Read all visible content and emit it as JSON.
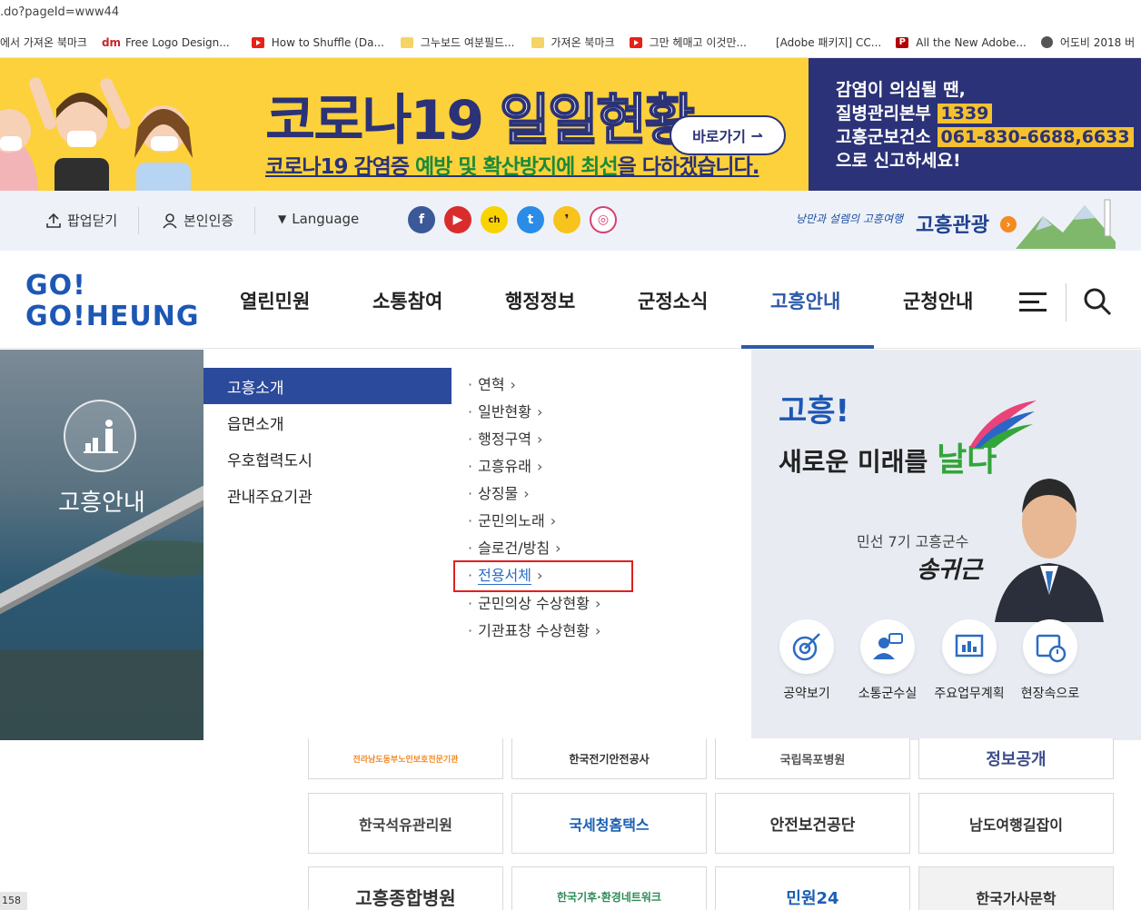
{
  "browser": {
    "url": ".do?pageId=www44",
    "bookmarks": [
      {
        "icon": "folder-icon",
        "label": "에서 가져온 북마크"
      },
      {
        "icon": "dm-icon",
        "label": "Free Logo Design..."
      },
      {
        "icon": "youtube-icon",
        "label": "How to Shuffle (Da..."
      },
      {
        "icon": "folder-icon",
        "label": "그누보드 여분필드..."
      },
      {
        "icon": "folder-icon",
        "label": "가져온 북마크"
      },
      {
        "icon": "youtube-icon",
        "label": "그만 헤매고 이것만..."
      },
      {
        "icon": "none",
        "label": "[Adobe 패키지] CC..."
      },
      {
        "icon": "p-icon",
        "label": "All the New Adobe..."
      },
      {
        "icon": "globe-icon",
        "label": "어도비 2018 버"
      }
    ],
    "status": "158"
  },
  "banner": {
    "title_a": "코로나19",
    "title_b": "일일현황",
    "subtitle_a": "코로나19 감염증 ",
    "subtitle_b": "예방 및 확산방지에 최선",
    "subtitle_c": "을 다하겠습니다.",
    "button": "바로가기",
    "right_line1": "감염이 의심될 땐,",
    "right_line2_a": "질병관리본부 ",
    "right_line2_b": "1339",
    "right_line3_a": "고흥군보건소 ",
    "right_line3_b": "061-830-6688,6633",
    "right_line4": "으로 신고하세요!"
  },
  "utility": {
    "popup_close": "팝업닫기",
    "verify": "본인인증",
    "language": "Language",
    "sns": [
      "facebook-icon",
      "youtube-icon",
      "kakaostory-icon",
      "twitter-icon",
      "kakao-icon",
      "instagram-icon"
    ],
    "tour_slogan": "낭만과 설렘의 고흥여행",
    "tour_logo": "고흥관광"
  },
  "nav": {
    "logo_line1": "GO!",
    "logo_line2": "GO!HEUNG",
    "items": [
      "열린민원",
      "소통참여",
      "행정정보",
      "군정소식",
      "고흥안내",
      "군청안내"
    ],
    "active": "고흥안내"
  },
  "mega": {
    "section_title": "고흥안내",
    "sub_items": [
      "고흥소개",
      "읍면소개",
      "우호협력도시",
      "관내주요기관"
    ],
    "links": [
      "연혁",
      "일반현황",
      "행정구역",
      "고흥유래",
      "상징물",
      "군민의노래",
      "슬로건/방침",
      "전용서체",
      "군민의상 수상현황",
      "기관표창 수상현황"
    ],
    "highlighted_link": "전용서체",
    "promo_line1": "고흥!",
    "promo_line2_a": "새로운 미래를 ",
    "promo_line2_b": "날다",
    "mayor_title": "민선 7기 고흥군수",
    "mayor_sign": "송귀근",
    "quick_links": [
      "공약보기",
      "소통군수실",
      "주요업무계획",
      "현장속으로"
    ]
  },
  "partners": [
    "전라남도동부노인보호전문기관",
    "한국전기안전공사",
    "국립목포병원",
    "정보공개",
    "한국석유관리원",
    "국세청홈택스",
    "안전보건공단",
    "남도여행길잡이",
    "고흥종합병원",
    "한국기후·환경네트워크",
    "민원24",
    "한국가사문학"
  ]
}
